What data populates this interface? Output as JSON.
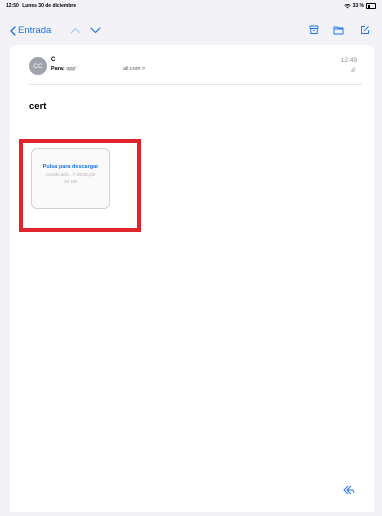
{
  "status_bar": {
    "time": "12:50",
    "date": "Lunes 30 de diciembre",
    "battery": "33 %"
  },
  "nav": {
    "back_label": "Entrada"
  },
  "message": {
    "avatar_initials": "CC",
    "sender": "C",
    "to_label": "Para:",
    "to_value": "app'",
    "to_tail": "ail.com >",
    "time": "12:49",
    "subject": "cert"
  },
  "attachment": {
    "title": "Pulsa para descargar",
    "filename": "Certificado...7-2026.pfx",
    "size": "10 KB"
  },
  "colors": {
    "accent": "#1a73e8",
    "highlight": "#e0242c"
  }
}
